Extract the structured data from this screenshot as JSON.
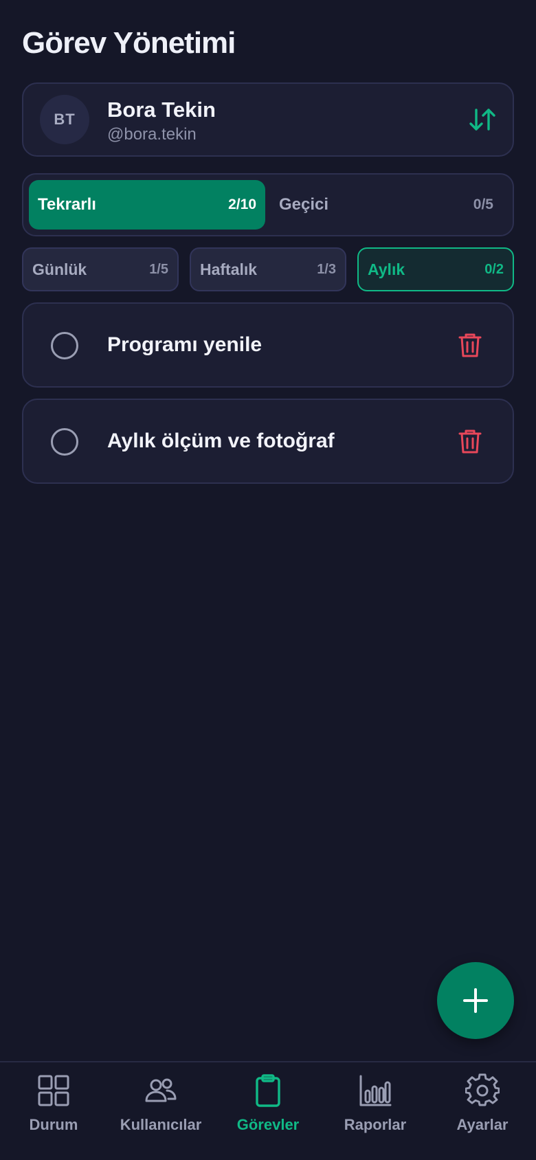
{
  "header": {
    "title": "Görev Yönetimi"
  },
  "user": {
    "initials": "BT",
    "name": "Bora Tekin",
    "handle": "@bora.tekin",
    "switch_icon": "swap-vertical-icon"
  },
  "segments": [
    {
      "label": "Tekrarlı",
      "count": "2/10",
      "active": true
    },
    {
      "label": "Geçici",
      "count": "0/5",
      "active": false
    }
  ],
  "filters": [
    {
      "label": "Günlük",
      "count": "1/5",
      "active": false
    },
    {
      "label": "Haftalık",
      "count": "1/3",
      "active": false
    },
    {
      "label": "Aylık",
      "count": "0/2",
      "active": true
    }
  ],
  "tasks": [
    {
      "title": "Programı yenile",
      "done": false
    },
    {
      "title": "Aylık ölçüm ve fotoğraf",
      "done": false
    }
  ],
  "fab": {
    "icon": "plus-icon"
  },
  "tabs": [
    {
      "label": "Durum",
      "icon": "grid-icon",
      "active": false
    },
    {
      "label": "Kullanıcılar",
      "icon": "users-icon",
      "active": false
    },
    {
      "label": "Görevler",
      "icon": "clipboard-icon",
      "active": true
    },
    {
      "label": "Raporlar",
      "icon": "bar-chart-icon",
      "active": false
    },
    {
      "label": "Ayarlar",
      "icon": "settings-icon",
      "active": false
    }
  ],
  "colors": {
    "background": "#151728",
    "card": "#1c1e33",
    "accent": "#028161",
    "accent_text": "#10b986",
    "danger": "#e8475a",
    "muted": "#9a9eb3"
  }
}
